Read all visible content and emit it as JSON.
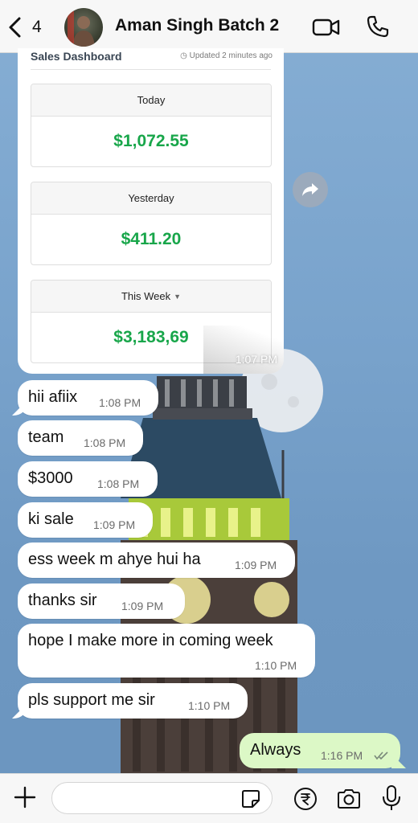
{
  "header": {
    "back_count": "4",
    "title": "Aman Singh Batch 2",
    "icons": {
      "back": "chevron-left-icon",
      "video": "video-camera-icon",
      "call": "phone-icon"
    }
  },
  "dashboard": {
    "title": "Sales Dashboard",
    "updated": "Updated 2 minutes ago",
    "metrics": [
      {
        "label": "Today",
        "value": "$1,072.55"
      },
      {
        "label": "Yesterday",
        "value": "$411.20"
      },
      {
        "label": "This Week",
        "value": "$3,183,69"
      }
    ],
    "time": "1:07 PM"
  },
  "messages": [
    {
      "text": "hii afiix",
      "time": "1:08 PM"
    },
    {
      "text": "team",
      "time": "1:08 PM"
    },
    {
      "text": "$3000",
      "time": "1:08 PM"
    },
    {
      "text": "ki sale",
      "time": "1:09 PM"
    },
    {
      "text": "ess week m ahye hui ha",
      "time": "1:09 PM"
    },
    {
      "text": "thanks sir",
      "time": "1:09 PM"
    },
    {
      "text": "hope I make more in coming week",
      "time": "1:10 PM"
    },
    {
      "text": "pls support me sir",
      "time": "1:10 PM"
    }
  ],
  "outgoing": {
    "text": "Always",
    "time": "1:16 PM"
  },
  "colors": {
    "accent_green": "#18a64a",
    "outgoing_bubble": "#dcf8c6",
    "header_bg": "#f7f7f7"
  }
}
